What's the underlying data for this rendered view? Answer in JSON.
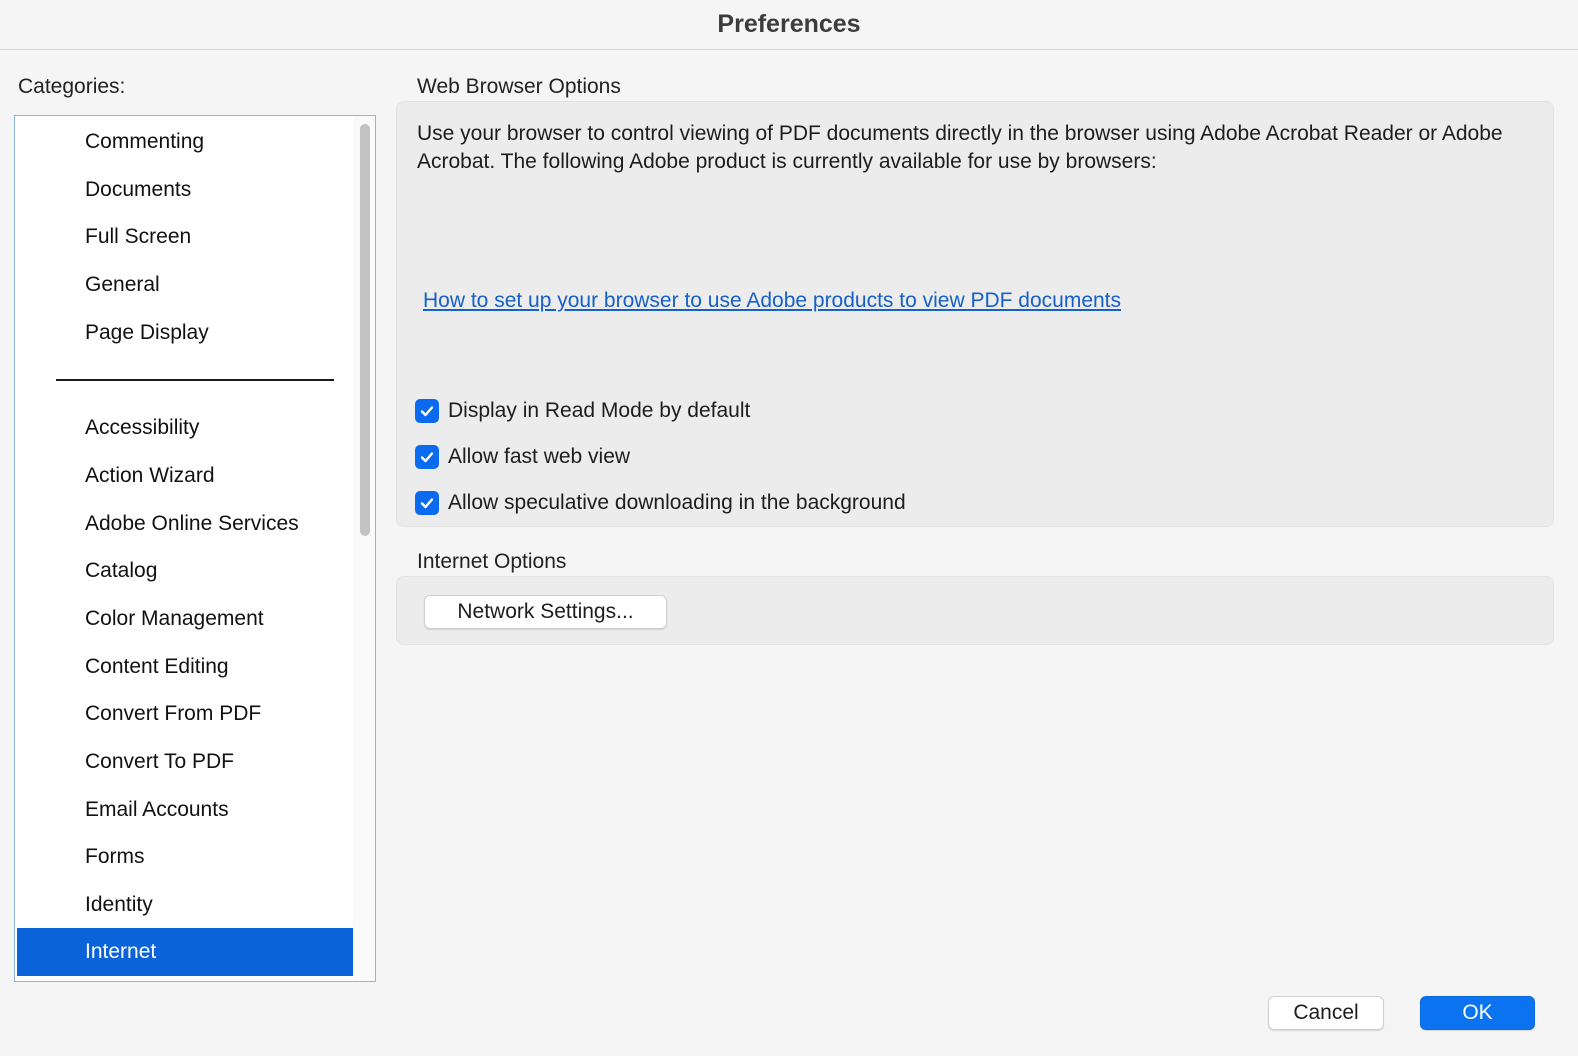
{
  "window": {
    "title": "Preferences"
  },
  "sidebar": {
    "label": "Categories:",
    "top_items": [
      {
        "label": "Commenting"
      },
      {
        "label": "Documents"
      },
      {
        "label": "Full Screen"
      },
      {
        "label": "General"
      },
      {
        "label": "Page Display"
      }
    ],
    "items": [
      {
        "label": "Accessibility"
      },
      {
        "label": "Action Wizard"
      },
      {
        "label": "Adobe Online Services"
      },
      {
        "label": "Catalog"
      },
      {
        "label": "Color Management"
      },
      {
        "label": "Content Editing"
      },
      {
        "label": "Convert From PDF"
      },
      {
        "label": "Convert To PDF"
      },
      {
        "label": "Email Accounts"
      },
      {
        "label": "Forms"
      },
      {
        "label": "Identity"
      },
      {
        "label": "Internet",
        "selected": true
      }
    ]
  },
  "web_browser": {
    "heading": "Web Browser Options",
    "description": "Use your browser to control viewing of PDF documents directly in the browser using Adobe Acrobat Reader or Adobe Acrobat. The following Adobe product is currently available for use by browsers:",
    "help_link": "How to set up your browser to use Adobe products to view PDF documents",
    "options": [
      {
        "label": "Display in Read Mode by default",
        "checked": true
      },
      {
        "label": "Allow fast web view",
        "checked": true
      },
      {
        "label": "Allow speculative downloading in the background",
        "checked": true
      }
    ]
  },
  "internet": {
    "heading": "Internet Options",
    "network_button": "Network Settings..."
  },
  "footer": {
    "cancel_label": "Cancel",
    "ok_label": "OK"
  },
  "colors": {
    "selection": "#0b63d9",
    "checkbox": "#0a6af0",
    "link": "#1560c9",
    "primary_button": "#0b73f0"
  }
}
